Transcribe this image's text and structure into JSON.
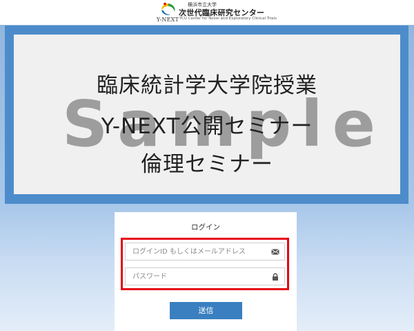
{
  "header": {
    "logo_text": "Y-NEXT",
    "org_small": "横浜市立大学",
    "org_main": "次世代臨床研究センター",
    "org_en": "YCU Center for Novel and Exploratory Clinical Trials"
  },
  "banner": {
    "line1": "臨床統計学大学院授業",
    "line2": "Y-NEXT公開セミナー",
    "line3": "倫理セミナー",
    "watermark": "Sample"
  },
  "login": {
    "title": "ログイン",
    "id_placeholder": "ログインID もしくはメールアドレス",
    "id_icon": "envelope-icon",
    "password_placeholder": "パスワード",
    "password_icon": "lock-icon",
    "submit_label": "送信"
  },
  "colors": {
    "banner_frame": "#4d8ccb",
    "highlight": "#e60012",
    "button": "#3a7fc0"
  }
}
